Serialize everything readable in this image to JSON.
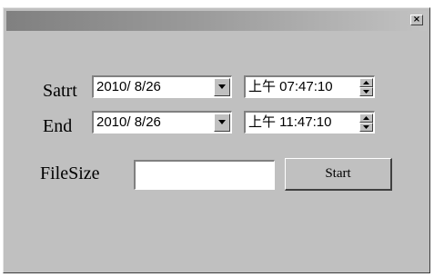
{
  "window": {
    "close_glyph": "×"
  },
  "form": {
    "start_label": "Satrt",
    "end_label": "End",
    "filesize_label": "FileSize",
    "start_date": "2010/ 8/26",
    "start_time": "上午 07:47:10",
    "end_date": "2010/ 8/26",
    "end_time": "上午 11:47:10",
    "filesize_value": "",
    "start_button": "Start"
  }
}
